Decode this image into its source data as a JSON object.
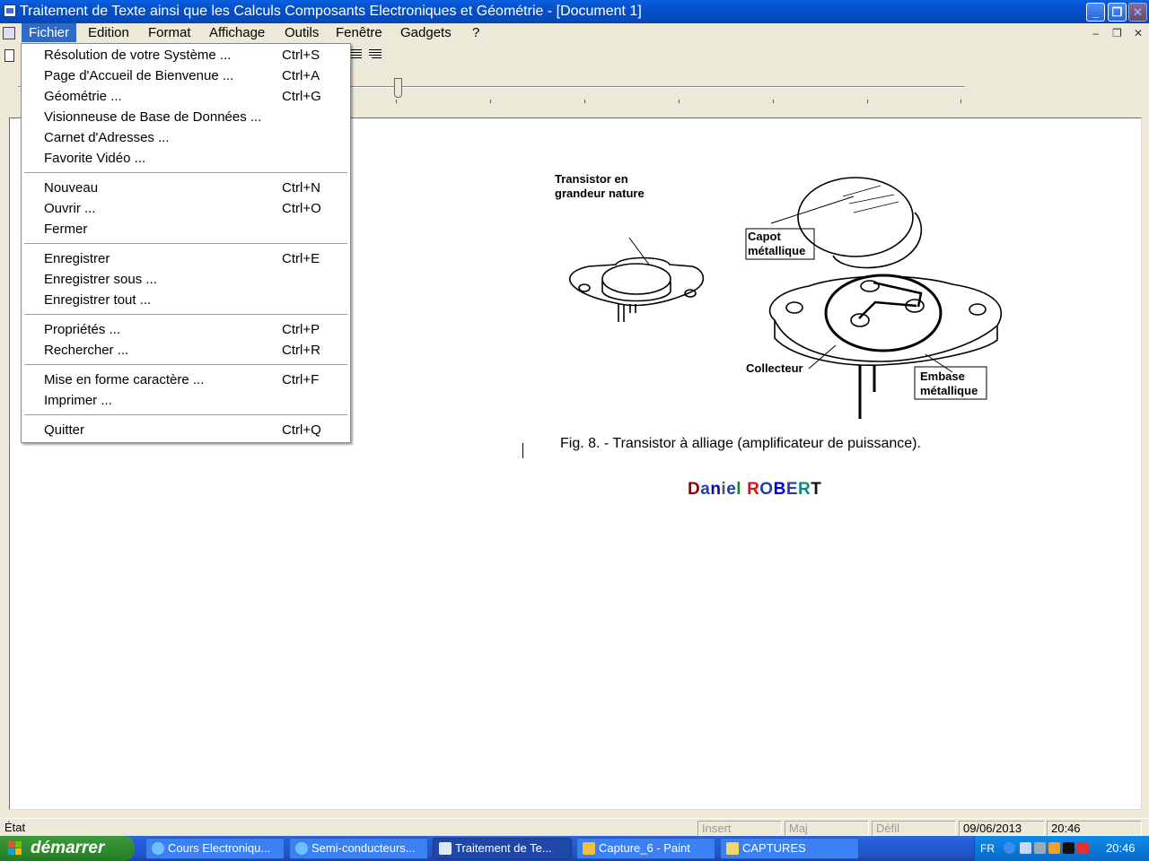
{
  "window": {
    "title": "Traitement de Texte ainsi que les Calculs Composants Electroniques et Géométrie - [Document 1]",
    "minimize": "_",
    "restore": "❐",
    "close": "✕"
  },
  "menubar": {
    "items": [
      "Fichier",
      "Edition",
      "Format",
      "Affichage",
      "Outils",
      "Fenêtre",
      "Gadgets",
      "?"
    ],
    "active": "Fichier",
    "mdi": [
      "–",
      "❐",
      "✕"
    ]
  },
  "fichier_menu": {
    "groups": [
      [
        {
          "label": "Résolution de votre Système ...",
          "shortcut": "Ctrl+S"
        },
        {
          "label": "Page d'Accueil de Bienvenue ...",
          "shortcut": "Ctrl+A"
        },
        {
          "label": "Géométrie ...",
          "shortcut": "Ctrl+G"
        },
        {
          "label": "Visionneuse de Base de Données ...",
          "shortcut": ""
        },
        {
          "label": "Carnet d'Adresses ...",
          "shortcut": ""
        },
        {
          "label": "Favorite Vidéo ...",
          "shortcut": ""
        }
      ],
      [
        {
          "label": "Nouveau",
          "shortcut": "Ctrl+N"
        },
        {
          "label": "Ouvrir ...",
          "shortcut": "Ctrl+O"
        },
        {
          "label": "Fermer",
          "shortcut": ""
        }
      ],
      [
        {
          "label": "Enregistrer",
          "shortcut": "Ctrl+E"
        },
        {
          "label": "Enregistrer sous ...",
          "shortcut": ""
        },
        {
          "label": "Enregistrer tout ...",
          "shortcut": ""
        }
      ],
      [
        {
          "label": "Propriétés ...",
          "shortcut": "Ctrl+P"
        },
        {
          "label": "Rechercher ...",
          "shortcut": "Ctrl+R"
        }
      ],
      [
        {
          "label": "Mise en forme caractère ...",
          "shortcut": "Ctrl+F"
        },
        {
          "label": "Imprimer ...",
          "shortcut": ""
        }
      ],
      [
        {
          "label": "Quitter",
          "shortcut": "Ctrl+Q"
        }
      ]
    ]
  },
  "document": {
    "figure_labels": {
      "transistor_line1": "Transistor en",
      "transistor_line2": "grandeur nature",
      "capot_line1": "Capot",
      "capot_line2": "métallique",
      "collecteur": "Collecteur",
      "embase_line1": "Embase",
      "embase_line2": "métallique"
    },
    "caption": "Fig. 8. - Transistor à alliage (amplificateur de puissance).",
    "author": {
      "letters": [
        {
          "ch": "D",
          "color": "#8b0000"
        },
        {
          "ch": "a",
          "color": "#1f3fb0"
        },
        {
          "ch": "n",
          "color": "#0000cc"
        },
        {
          "ch": "i",
          "color": "#555555"
        },
        {
          "ch": "e",
          "color": "#1f3fb0"
        },
        {
          "ch": "l",
          "color": "#0b8a2a"
        },
        {
          "ch": " ",
          "color": "#000000"
        },
        {
          "ch": "R",
          "color": "#dd1111"
        },
        {
          "ch": "O",
          "color": "#1f3fb0"
        },
        {
          "ch": "B",
          "color": "#0000cc"
        },
        {
          "ch": "E",
          "color": "#1f3fb0"
        },
        {
          "ch": "R",
          "color": "#0b8a7a"
        },
        {
          "ch": "T",
          "color": "#111111"
        }
      ]
    }
  },
  "statusbar": {
    "etat": "État",
    "insert": "Insert",
    "maj": "Maj",
    "defil": "Défil",
    "date": "09/06/2013",
    "time": "20:46"
  },
  "taskbar": {
    "start": "démarrer",
    "tasks": [
      {
        "label": "Cours Electroniqu...",
        "icon": "ie-icon"
      },
      {
        "label": "Semi-conducteurs...",
        "icon": "ie-icon"
      },
      {
        "label": "Traitement de Te...",
        "icon": "app-icon",
        "active": true
      },
      {
        "label": "Capture_6 - Paint",
        "icon": "paint-icon"
      },
      {
        "label": "CAPTURES",
        "icon": "folder-icon"
      }
    ],
    "tray": {
      "lang": "FR",
      "clock": "20:46"
    }
  }
}
